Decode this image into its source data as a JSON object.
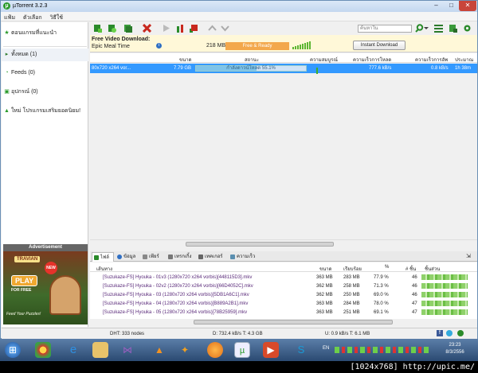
{
  "window": {
    "title": "µTorrent 3.2.3",
    "min": "–",
    "max": "□",
    "close": "✕"
  },
  "menu": [
    "แฟ้ม",
    "ตัวเลือก",
    "วิธีใช้"
  ],
  "sidebar": {
    "items": [
      {
        "label": "ตอนแกรมที่แนะนำ",
        "icon": "star-icon"
      },
      {
        "label": "ทั้งหมด (1)",
        "icon": "torrents-icon"
      },
      {
        "label": "Feeds (0)",
        "icon": "rss-icon"
      },
      {
        "label": "อุปกรณ์ (0)",
        "icon": "device-icon"
      },
      {
        "label": "ใหม่ โปรแกรมเสริมยอดนิยม!",
        "icon": "apps-icon"
      }
    ],
    "ad_title": "Advertisement",
    "ad": {
      "logo": "TRAVIAN",
      "badge": "NEW",
      "play": "PLAY",
      "free": "FOR FREE",
      "sub": "Feed Your Puzzles!"
    }
  },
  "toolbar": {
    "search_placeholder": "ค้นหาใน",
    "buttons": [
      "add-torrent-icon",
      "add-url-icon",
      "create-torrent-icon",
      "remove-icon",
      "start-icon",
      "pause-icon",
      "stop-icon",
      "up-icon",
      "down-icon"
    ]
  },
  "promo": {
    "title": "Free Video Download:",
    "name": "Epic Meal Time",
    "size": "218 MB",
    "status": "Free & Ready",
    "button": "Instant Download"
  },
  "torrent_columns": [
    "ขนาด",
    "สถานะ",
    "ความสมบูรณ์",
    "ความเร็วการโหลด",
    "ความเร็วการอัพ",
    "ประมาณ"
  ],
  "torrent": {
    "name": "80x720 x264 vor...",
    "size": "7.79 GB",
    "status": "กำลังดาวน์โหลด 55.1%",
    "progress": 55.1,
    "down": "777.6 kB/s",
    "up": "0.8 kB/s",
    "eta": "1h 38m"
  },
  "detail_tabs": [
    "ไฟล์",
    "ข้อมูล",
    "เพียร์",
    "เทรกเกิ้ง",
    "เทคเกอร์",
    "ความเร็ว"
  ],
  "file_columns": [
    "เส้นทาง",
    "ขนาด",
    "เรียบร้อย",
    "%",
    "# ชิ้น",
    "ชิ้นส่วน"
  ],
  "files": [
    {
      "name": "[Suzukaze-FS] Hyouka - 01v3 (1280x720 x264 vorbis)[448115D3].mkv",
      "size": "363 MB",
      "done": "283 MB",
      "pct": "77.9 %",
      "pieces": "46"
    },
    {
      "name": "[Suzukaze-FS] Hyouka - 02v2 (1280x720 x264 vorbis)[66D4052C].mkv",
      "size": "362 MB",
      "done": "258 MB",
      "pct": "71.3 %",
      "pieces": "46"
    },
    {
      "name": "[Suzukaze-FS] Hyouka - 03 (1280x720 x264 vorbis)[5DB1A6C1].mkv",
      "size": "362 MB",
      "done": "250 MB",
      "pct": "69.0 %",
      "pieces": "46"
    },
    {
      "name": "[Suzukaze-FS] Hyouka - 04 (1280x720 x264 vorbis)[B889A2B1].mkv",
      "size": "363 MB",
      "done": "284 MB",
      "pct": "78.0 %",
      "pieces": "47"
    },
    {
      "name": "[Suzukaze-FS] Hyouka - 05 (1280x720 x264 vorbis)[78B25959].mkv",
      "size": "363 MB",
      "done": "251 MB",
      "pct": "69.1 %",
      "pieces": "47"
    }
  ],
  "status": {
    "dht": "DHT: 333 nodes",
    "down": "D: 732.4 kB/s T: 4.3 GB",
    "up": "U: 0.9 kB/s T: 6.1 MB"
  },
  "taskbar": {
    "lang": "EN",
    "time": "23:23",
    "date": "8/3/2556"
  },
  "watermark": "[1024x768] http://upic.me/"
}
